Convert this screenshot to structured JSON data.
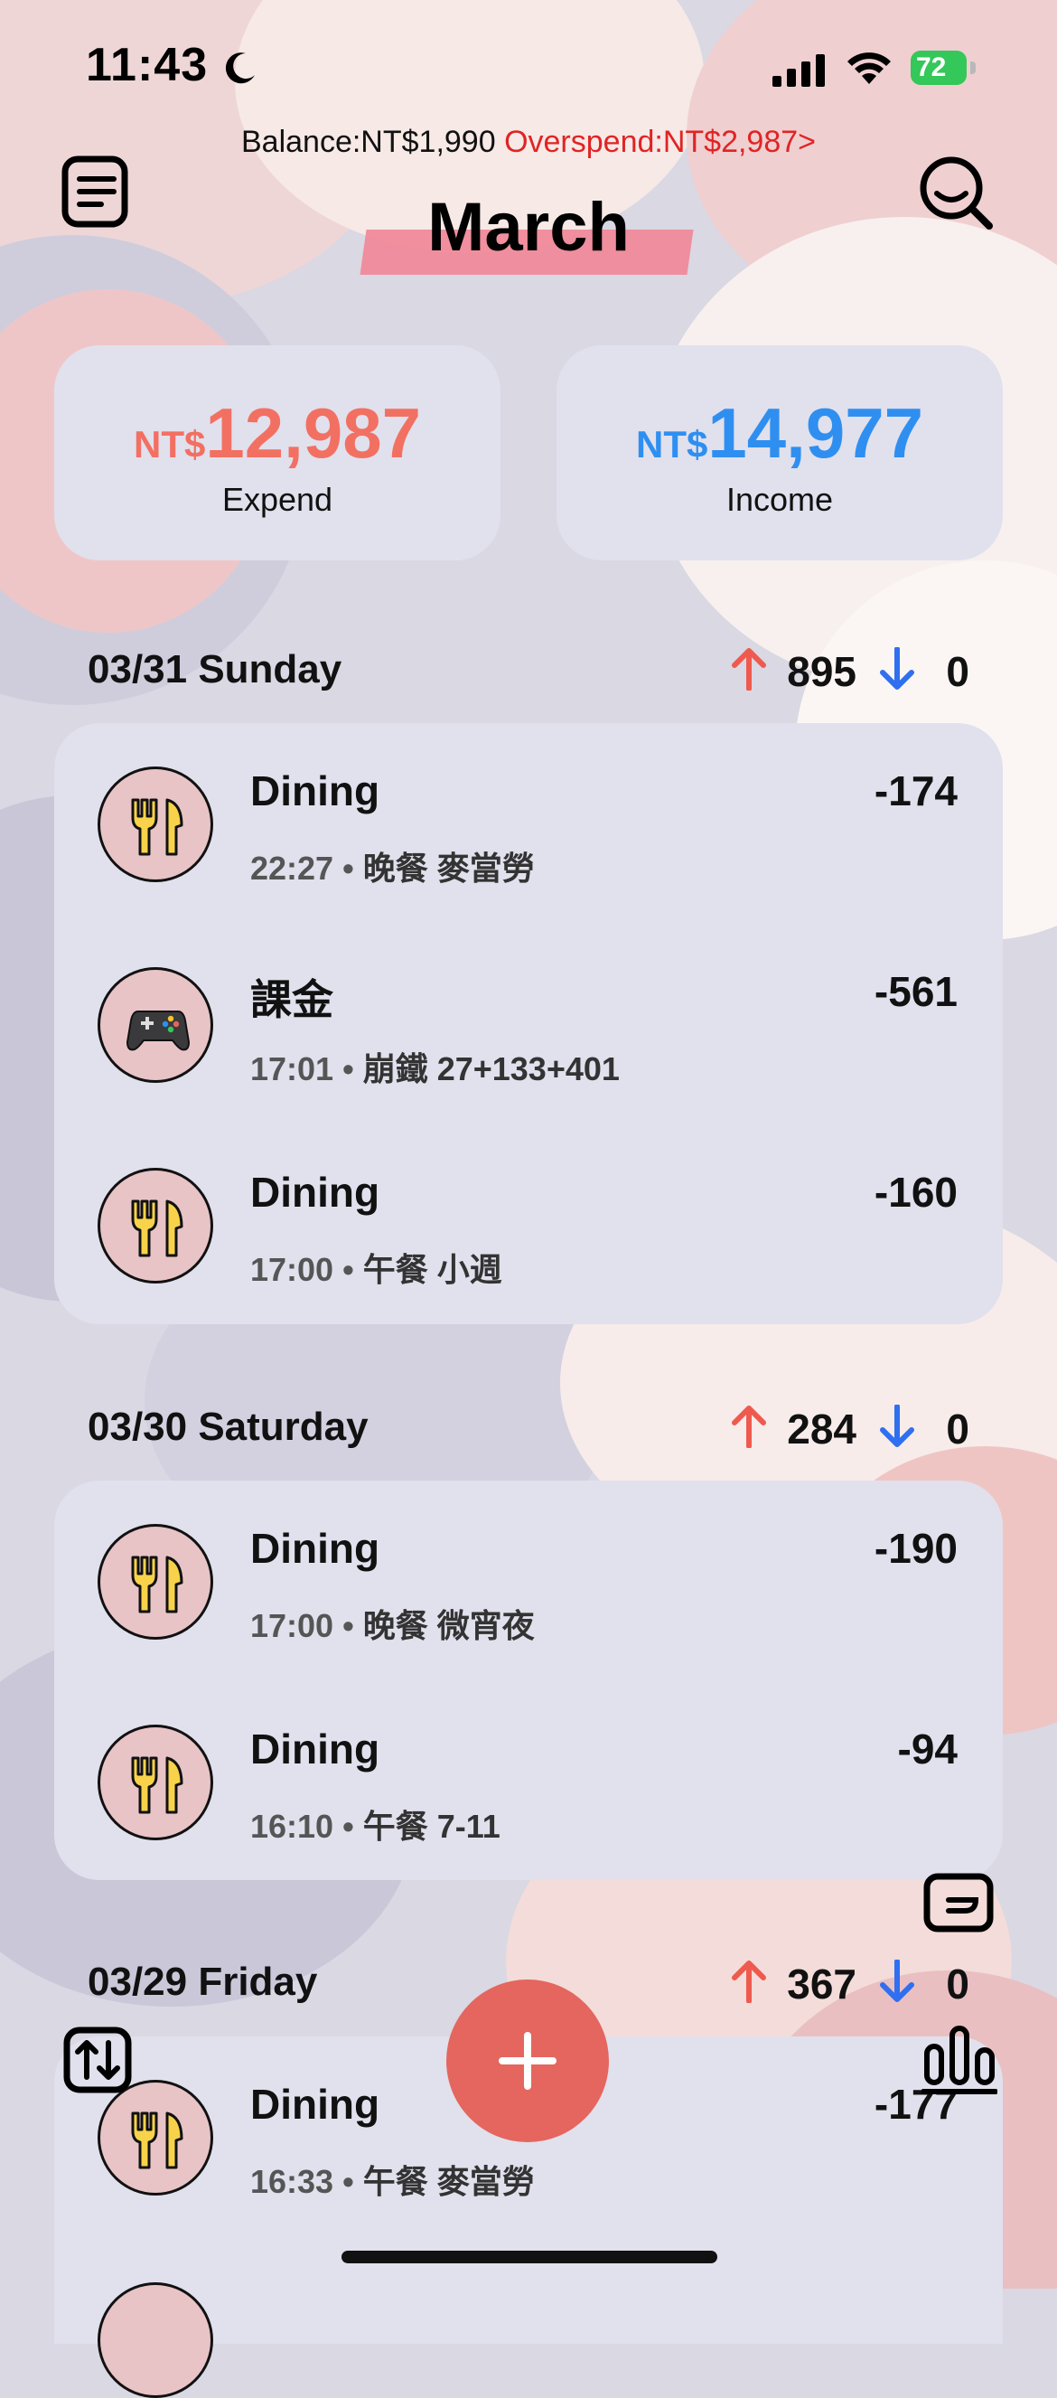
{
  "status_bar": {
    "time": "11:43",
    "battery": "72"
  },
  "header": {
    "balance": "Balance:NT$1,990",
    "overspend": "Overspend:NT$2,987>",
    "month": "March"
  },
  "summary": {
    "expend": {
      "currency": "NT$",
      "amount": "12,987",
      "label": "Expend",
      "color": "#f27062"
    },
    "income": {
      "currency": "NT$",
      "amount": "14,977",
      "label": "Income",
      "color": "#2f8ff0"
    }
  },
  "days": [
    {
      "date": "03/31 Sunday",
      "out": "895",
      "in": "0",
      "transactions": [
        {
          "icon": "fork-knife-icon",
          "category": "Dining",
          "time": "22:27",
          "note": "晚餐 麥當勞",
          "amount": "-174"
        },
        {
          "icon": "gamepad-icon",
          "category": "課金",
          "time": "17:01",
          "note": "崩鐵 27+133+401",
          "amount": "-561"
        },
        {
          "icon": "fork-knife-icon",
          "category": "Dining",
          "time": "17:00",
          "note": "午餐 小週",
          "amount": "-160"
        }
      ]
    },
    {
      "date": "03/30 Saturday",
      "out": "284",
      "in": "0",
      "transactions": [
        {
          "icon": "fork-knife-icon",
          "category": "Dining",
          "time": "17:00",
          "note": "晚餐 微宵夜",
          "amount": "-190"
        },
        {
          "icon": "fork-knife-icon",
          "category": "Dining",
          "time": "16:10",
          "note": "午餐 7-11",
          "amount": "-94"
        }
      ]
    },
    {
      "date": "03/29 Friday",
      "out": "367",
      "in": "0",
      "transactions": [
        {
          "icon": "fork-knife-icon",
          "category": "Dining",
          "time": "16:33",
          "note": "午餐 麥當勞",
          "amount": "-177"
        }
      ]
    }
  ],
  "colors": {
    "up_arrow": "#ef5a4e",
    "down_arrow": "#2f6ff0",
    "fab": "#e4665e"
  }
}
